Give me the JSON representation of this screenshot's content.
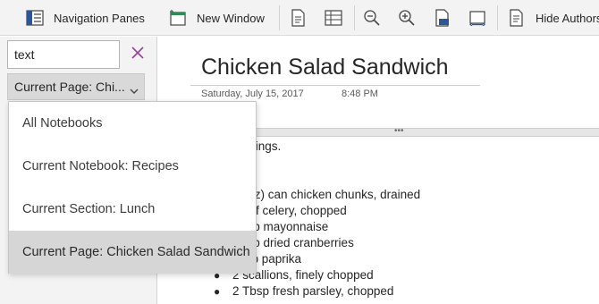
{
  "toolbar": {
    "navigation_panes_label": "Navigation Panes",
    "new_window_label": "New Window",
    "hide_authors_label": "Hide Authors"
  },
  "search": {
    "value": "text",
    "scope_selected": "Current Page: Chi..."
  },
  "dropdown": {
    "items": [
      "All Notebooks",
      "Current Notebook: Recipes",
      "Current Section: Lunch",
      "Current Page: Chicken Salad Sandwich"
    ],
    "selected_index": 3
  },
  "page": {
    "title": "Chicken Salad Sandwich",
    "date": "Saturday, July 15, 2017",
    "time": "8:48 PM",
    "lines": [
      "ervings.",
      "s",
      "0 oz) can chicken chunks, drained",
      "s of celery, chopped",
      "cup mayonnaise",
      "cup dried cranberries",
      "tsp paprika",
      "2 scallions, finely chopped",
      "2 Tbsp fresh parsley, chopped"
    ]
  },
  "colors": {
    "toolbar_bg": "#f3f3f3",
    "selected_item_bg": "#d6d6d6",
    "clear_icon": "#9b3f9b",
    "spellcheck": "#e02020"
  },
  "icons": [
    "navigation-panes-icon",
    "new-window-icon",
    "page-view-icon",
    "table-view-icon",
    "zoom-out-icon",
    "zoom-in-icon",
    "zoom-100-icon",
    "page-width-icon",
    "hide-authors-icon",
    "clear-search-icon",
    "chevron-down-icon"
  ]
}
